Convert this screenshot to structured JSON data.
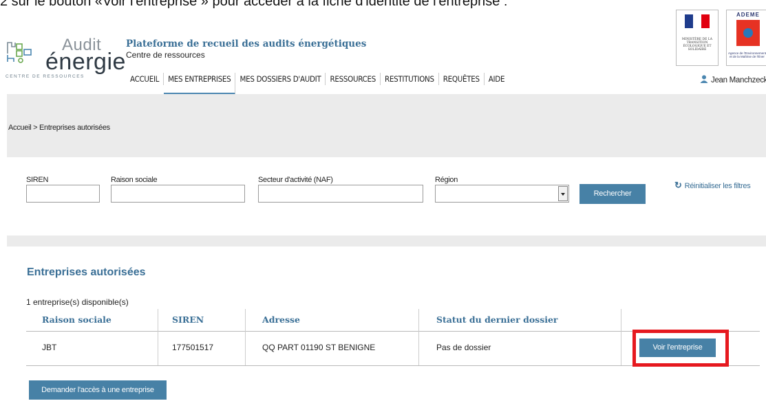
{
  "instruction": "2 sur le bouton «Voir l'entreprise » pour accéder à la fiche d'identité de l'entreprise :",
  "logo": {
    "audit": "Audit",
    "energie": "énergie",
    "centre": "CENTRE DE RESSOURCES"
  },
  "header": {
    "title": "Plateforme de recueil des audits énergétiques",
    "subtitle": "Centre de ressources"
  },
  "partners": {
    "ministere": "MINISTÈRE DE LA TRANSITION ÉCOLOGIQUE ET SOLIDAIRE",
    "ademe_name": "ADEME",
    "ademe_caption": "Agence de l'Environnement et de la Maîtrise de l'Éner"
  },
  "nav": {
    "items": [
      {
        "label": "ACCUEIL"
      },
      {
        "label": "MES ENTREPRISES"
      },
      {
        "label": "MES DOSSIERS D'AUDIT"
      },
      {
        "label": "RESSOURCES"
      },
      {
        "label": "RESTITUTIONS"
      },
      {
        "label": "REQUÊTES"
      },
      {
        "label": "AIDE"
      }
    ],
    "active_index": 1
  },
  "user": {
    "name": "Jean Manchzeck"
  },
  "breadcrumb": "Accueil > Entreprises autorisées",
  "filters": {
    "siren_label": "SIREN",
    "raison_label": "Raison sociale",
    "secteur_label": "Secteur d'activité (NAF)",
    "region_label": "Région",
    "search_button": "Rechercher",
    "reset_label": "Réinitialiser les filtres"
  },
  "results": {
    "title": "Entreprises autorisées",
    "count": "1 entreprise(s) disponible(s)",
    "columns": [
      "Raison sociale",
      "SIREN",
      "Adresse",
      "Statut du dernier dossier"
    ],
    "rows": [
      {
        "raison": "JBT",
        "siren": "177501517",
        "adresse": "QQ PART 01190 ST BENIGNE",
        "statut": "Pas de dossier",
        "action": "Voir l'entreprise"
      }
    ],
    "request_button": "Demander l'accès à une entreprise"
  },
  "colors": {
    "accent": "#4781a6",
    "title_blue": "#3a6f96",
    "highlight": "#e6191f"
  }
}
